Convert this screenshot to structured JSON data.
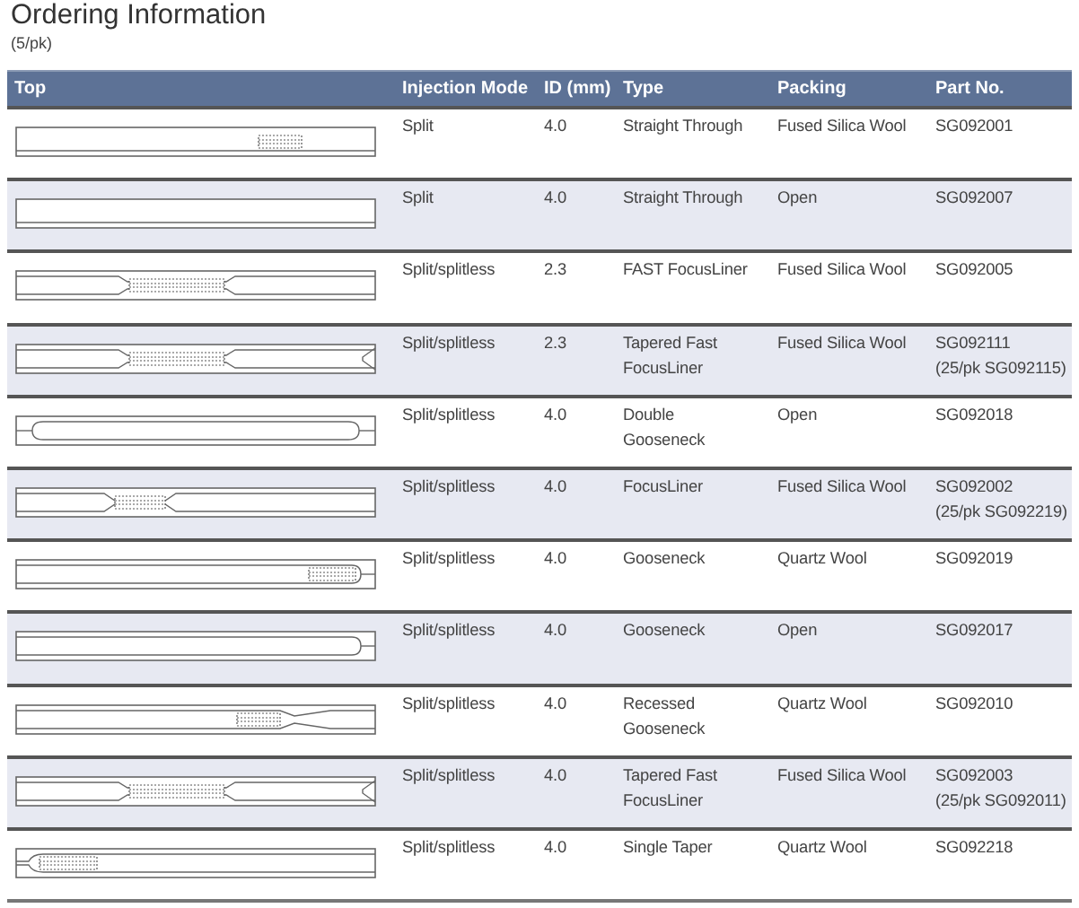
{
  "title": "Ordering Information",
  "subtitle": "(5/pk)",
  "columns": [
    "Top",
    "Injection Mode",
    "ID (mm)",
    "Type",
    "Packing",
    "Part No."
  ],
  "rows": [
    {
      "kind": "straight-wool",
      "mode": "Split",
      "id": "4.0",
      "type": [
        "Straight Through"
      ],
      "packing": "Fused Silica Wool",
      "part": [
        "SG092001"
      ]
    },
    {
      "kind": "straight",
      "mode": "Split",
      "id": "4.0",
      "type": [
        "Straight Through"
      ],
      "packing": "Open",
      "part": [
        "SG092007"
      ]
    },
    {
      "kind": "fast-focus",
      "mode": "Split/splitless",
      "id": "2.3",
      "type": [
        "FAST FocusLiner"
      ],
      "packing": "Fused Silica Wool",
      "part": [
        "SG092005"
      ]
    },
    {
      "kind": "tapered-fast",
      "mode": "Split/splitless",
      "id": "2.3",
      "type": [
        "Tapered Fast",
        "FocusLiner"
      ],
      "packing": "Fused Silica Wool",
      "part": [
        "SG092111",
        "(25/pk SG092115)"
      ]
    },
    {
      "kind": "double-gooseneck",
      "mode": "Split/splitless",
      "id": "4.0",
      "type": [
        "Double",
        "Gooseneck"
      ],
      "packing": "Open",
      "part": [
        "SG092018"
      ]
    },
    {
      "kind": "focus",
      "mode": "Split/splitless",
      "id": "4.0",
      "type": [
        "FocusLiner"
      ],
      "packing": "Fused Silica Wool",
      "part": [
        "SG092002",
        "(25/pk SG092219)"
      ]
    },
    {
      "kind": "gooseneck-wool",
      "mode": "Split/splitless",
      "id": "4.0",
      "type": [
        "Gooseneck"
      ],
      "packing": "Quartz Wool",
      "part": [
        "SG092019"
      ]
    },
    {
      "kind": "gooseneck",
      "mode": "Split/splitless",
      "id": "4.0",
      "type": [
        "Gooseneck"
      ],
      "packing": "Open",
      "part": [
        "SG092017"
      ]
    },
    {
      "kind": "recessed-gooseneck",
      "mode": "Split/splitless",
      "id": "4.0",
      "type": [
        "Recessed",
        "Gooseneck"
      ],
      "packing": "Quartz Wool",
      "part": [
        "SG092010"
      ]
    },
    {
      "kind": "tapered-fast-4",
      "mode": "Split/splitless",
      "id": "4.0",
      "type": [
        "Tapered Fast",
        "FocusLiner"
      ],
      "packing": "Fused Silica Wool",
      "part": [
        "SG092003",
        "(25/pk SG092011)"
      ]
    },
    {
      "kind": "single-taper",
      "mode": "Split/splitless",
      "id": "4.0",
      "type": [
        "Single Taper"
      ],
      "packing": "Quartz Wool",
      "part": [
        "SG092218"
      ]
    }
  ]
}
